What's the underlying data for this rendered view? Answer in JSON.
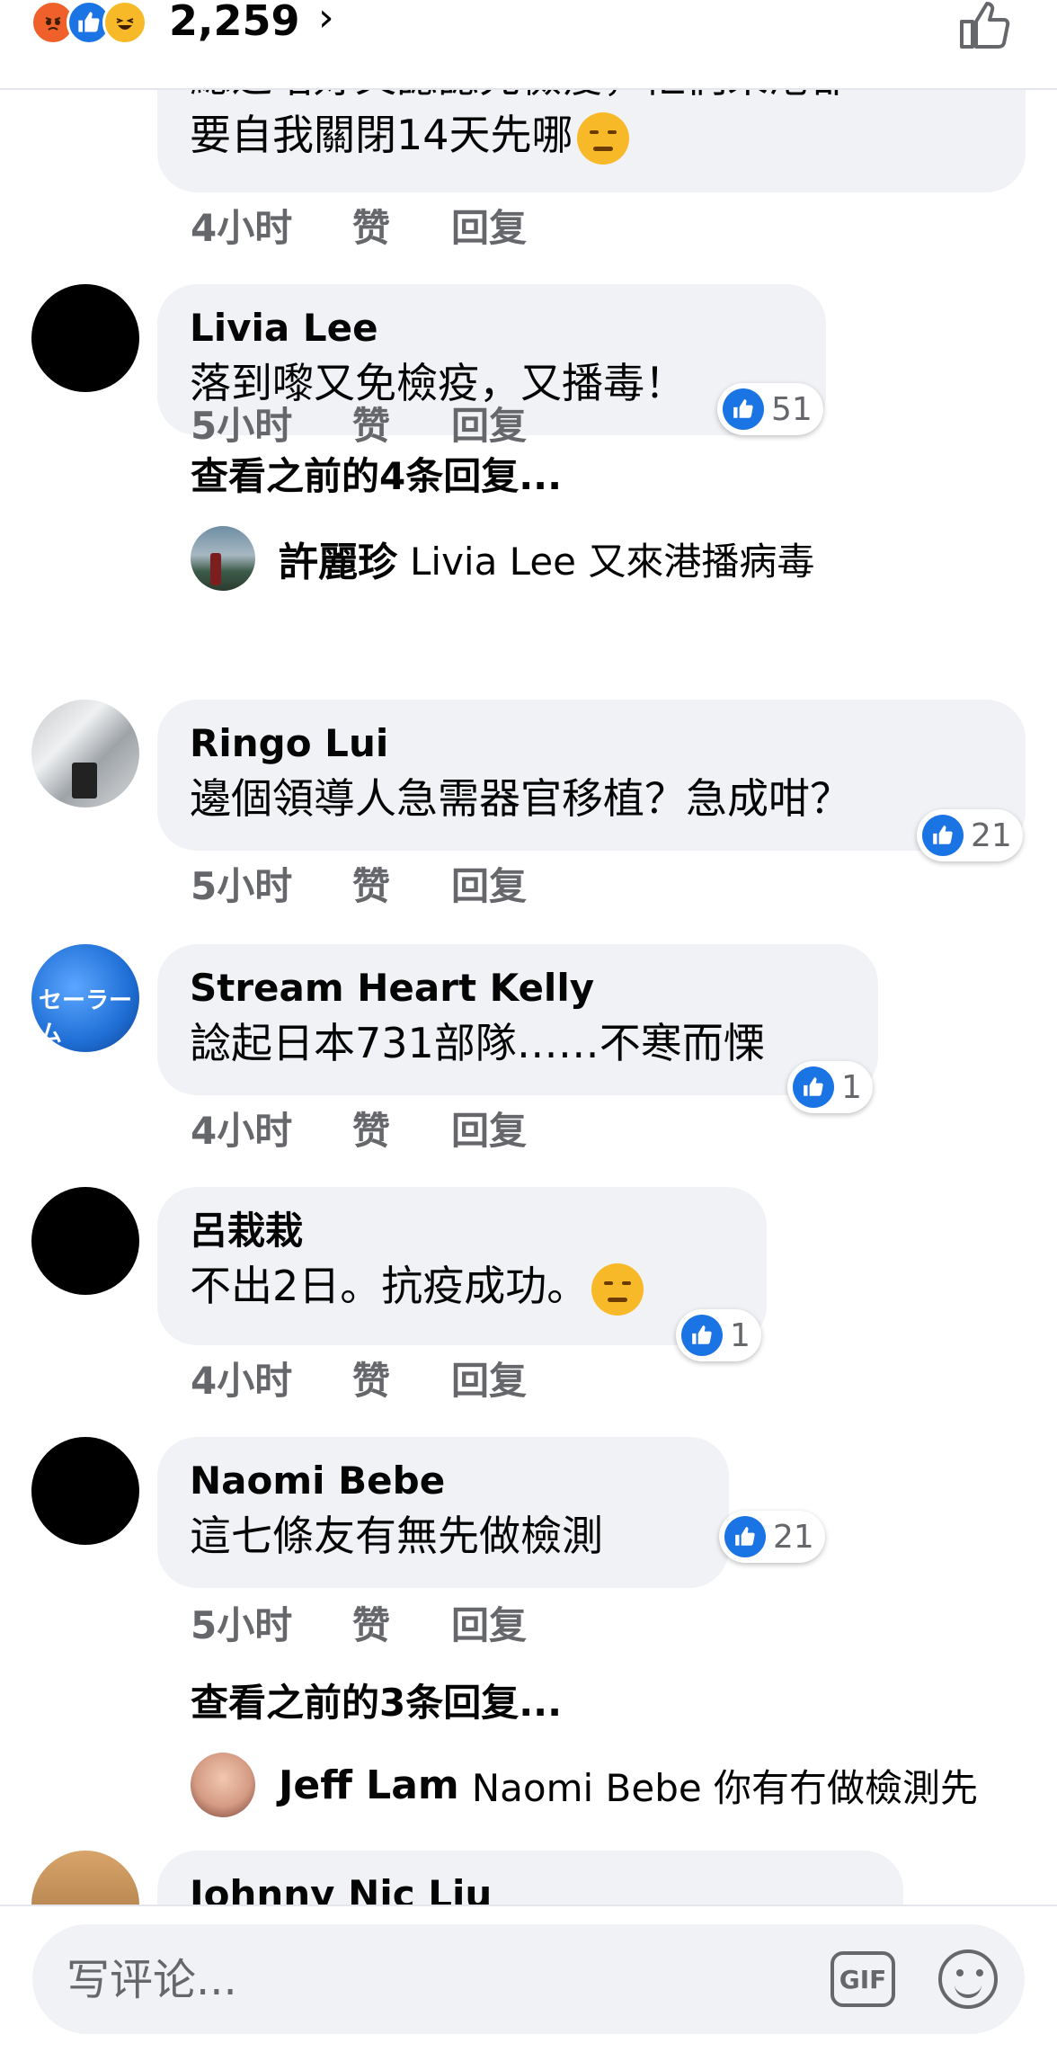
{
  "header": {
    "reaction_count": "2,259",
    "chevron": "›",
    "reaction_icons": [
      "angry-icon",
      "like-icon",
      "haha-icon"
    ]
  },
  "comments": [
    {
      "name": "",
      "text_partial_top": "總之唔好又諗諗先檢疫，佢們來港都",
      "text": "要自我關閉14天先哪",
      "has_emoji": "pensive-face-icon",
      "time": "4小时",
      "like": "赞",
      "reply": "回复"
    },
    {
      "name": "Livia Lee",
      "text": "落到嚟又免檢疫，又播毒！",
      "time": "5小时",
      "like": "赞",
      "reply": "回复",
      "reaction_count": "51",
      "view_more": "查看之前的4条回复...",
      "reply_preview": {
        "name": "許麗珍",
        "text": "Livia Lee 又來港播病毒"
      }
    },
    {
      "name": "Ringo Lui",
      "text": "邊個領導人急需器官移植？急成咁？",
      "time": "5小时",
      "like": "赞",
      "reply": "回复",
      "reaction_count": "21"
    },
    {
      "name": "Stream Heart Kelly",
      "text": "諗起日本731部隊……不寒而慄",
      "time": "4小时",
      "like": "赞",
      "reply": "回复",
      "reaction_count": "1"
    },
    {
      "name": "呂栽栽",
      "text": "不出2日。抗疫成功。",
      "has_emoji": "smirking-face-icon",
      "time": "4小时",
      "like": "赞",
      "reply": "回复",
      "reaction_count": "1"
    },
    {
      "name": "Naomi Bebe",
      "text": "這七條友有無先做檢測",
      "time": "5小时",
      "like": "赞",
      "reply": "回复",
      "reaction_count": "21",
      "view_more": "查看之前的3条回复...",
      "reply_preview": {
        "name": "Jeff Lam",
        "text": "Naomi Bebe 你有冇做檢測先"
      }
    },
    {
      "name": "Johnny Nic Liu"
    }
  ],
  "composer": {
    "placeholder": "写评论...",
    "gif_label": "GIF"
  },
  "colors": {
    "bubble_bg": "#f0f2f5",
    "meta_text": "#65676b",
    "like_blue": "#1b74e4"
  }
}
